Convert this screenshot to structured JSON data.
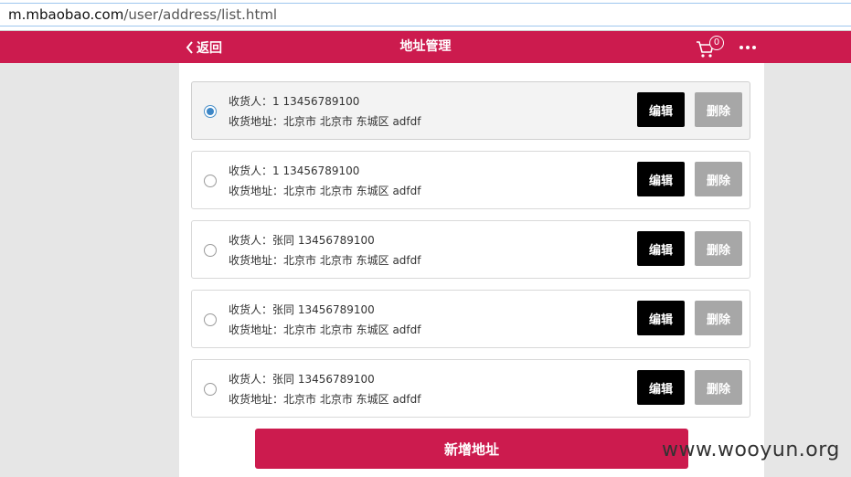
{
  "browser": {
    "url_host": "m.mbaobao.com",
    "url_path": "/user/address/list.html"
  },
  "header": {
    "back_label": "返回",
    "title": "地址管理",
    "cart_count": "0",
    "cart_icon": "cart-icon",
    "more_icon": "more-dots-icon",
    "bg_color": "#cc1b4e"
  },
  "addresses": [
    {
      "selected": true,
      "recipient": "收货人：1 13456789100",
      "address": "收货地址：北京市 北京市 东城区 adfdf"
    },
    {
      "selected": false,
      "recipient": "收货人：1 13456789100",
      "address": "收货地址：北京市 北京市 东城区 adfdf"
    },
    {
      "selected": false,
      "recipient": "收货人：张同 13456789100",
      "address": "收货地址：北京市 北京市 东城区 adfdf"
    },
    {
      "selected": false,
      "recipient": "收货人：张同 13456789100",
      "address": "收货地址：北京市 北京市 东城区 adfdf"
    },
    {
      "selected": false,
      "recipient": "收货人：张同 13456789100",
      "address": "收货地址：北京市 北京市 东城区 adfdf"
    }
  ],
  "buttons": {
    "edit_label": "编辑",
    "delete_label": "删除",
    "add_label": "新增地址"
  },
  "watermark": "www.wooyun.org"
}
